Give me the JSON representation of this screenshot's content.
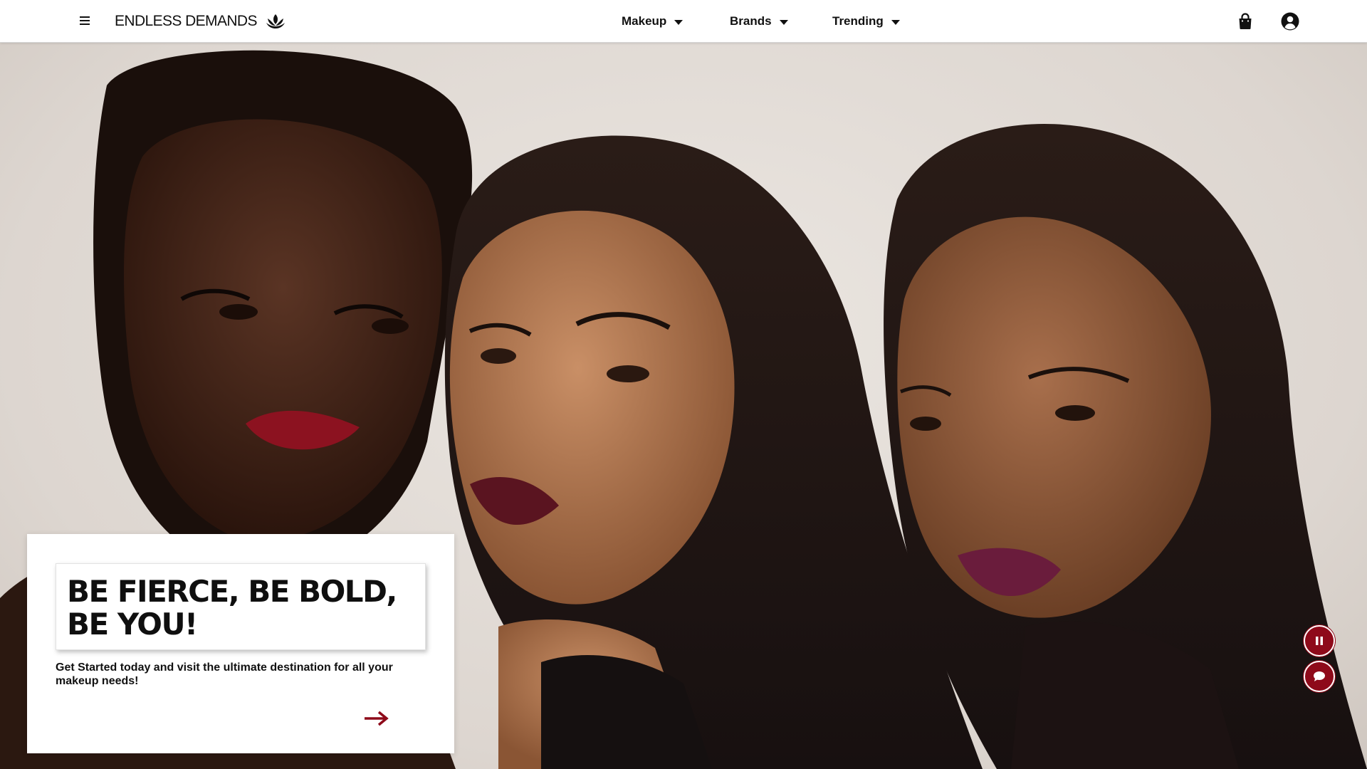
{
  "brand": {
    "name": "ENDLESS DEMANDS",
    "logo_icon": "lotus-icon"
  },
  "nav": {
    "menu_icon": "hamburger-icon",
    "items": [
      {
        "label": "Makeup",
        "icon": "caret-down-icon"
      },
      {
        "label": "Brands",
        "icon": "caret-down-icon"
      },
      {
        "label": "Trending",
        "icon": "caret-down-icon"
      }
    ],
    "cart_icon": "shopping-bag-icon",
    "account_icon": "user-circle-icon"
  },
  "hero": {
    "headline": "BE FIERCE, BE BOLD, BE YOU!",
    "subcopy": "Get Started today and visit the ultimate destination for all your makeup needs!",
    "cta_icon": "arrow-right-icon",
    "pause_icon": "pause-icon",
    "chat_icon": "chat-bubble-icon"
  },
  "colors": {
    "accent": "#8e0a1a",
    "nav_text": "#111111",
    "background": "#ffffff",
    "hero_backdrop": "#e4ded8"
  }
}
